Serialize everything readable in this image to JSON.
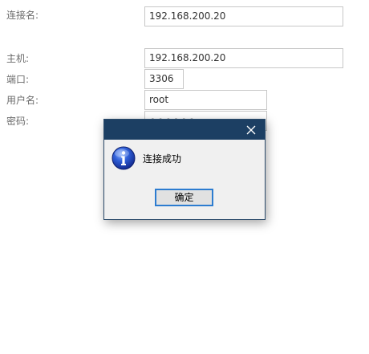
{
  "form": {
    "connection_name_label": "连接名:",
    "connection_name_value": "192.168.200.20",
    "host_label": "主机:",
    "host_value": "192.168.200.20",
    "port_label": "端口:",
    "port_value": "3306",
    "username_label": "用户名:",
    "username_value": "root",
    "password_label": "密码:",
    "password_mask": "●●●●●●"
  },
  "dialog": {
    "close_icon": "close-icon",
    "icon": "info-icon",
    "message": "连接成功",
    "ok_label": "确定"
  },
  "colors": {
    "titlebar": "#1c3f63",
    "ok_border": "#2c7cd0",
    "label_text": "#6a6a6a"
  }
}
